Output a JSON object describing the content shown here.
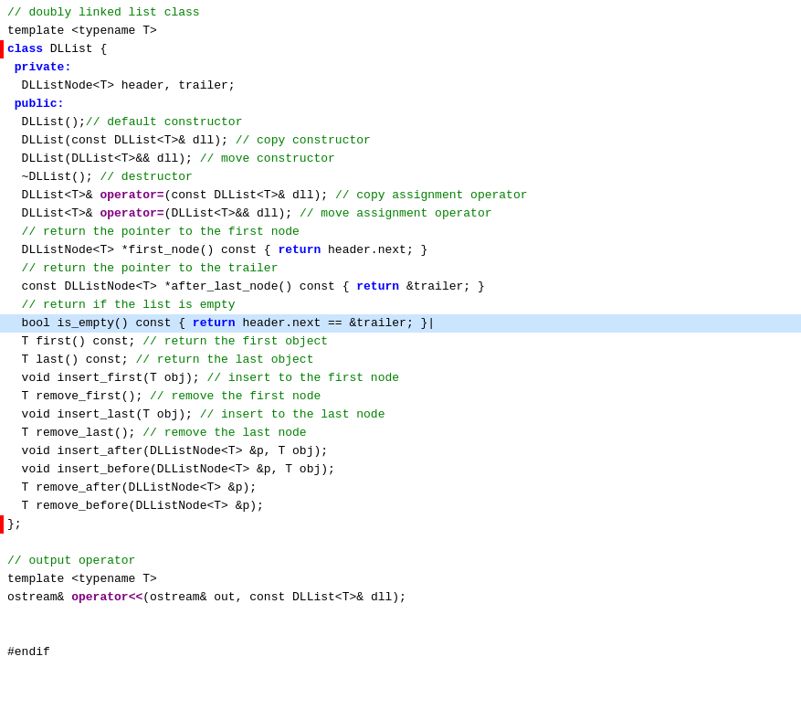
{
  "code": {
    "title": "C++ DLList class code",
    "lines": [
      {
        "id": 1,
        "highlighted": false,
        "red_marker": false,
        "tokens": [
          {
            "cls": "c-comment",
            "text": "// doubly linked list class"
          }
        ]
      },
      {
        "id": 2,
        "highlighted": false,
        "red_marker": false,
        "tokens": [
          {
            "cls": "c-normal",
            "text": "template <typename T>"
          }
        ]
      },
      {
        "id": 3,
        "highlighted": false,
        "red_marker": true,
        "tokens": [
          {
            "cls": "c-keyword",
            "text": "class"
          },
          {
            "cls": "c-normal",
            "text": " DLList {"
          }
        ]
      },
      {
        "id": 4,
        "highlighted": false,
        "red_marker": false,
        "tokens": [
          {
            "cls": "c-keyword",
            "text": " private:"
          }
        ]
      },
      {
        "id": 5,
        "highlighted": false,
        "red_marker": false,
        "tokens": [
          {
            "cls": "c-normal",
            "text": "  DLListNode<T> header, trailer;"
          }
        ]
      },
      {
        "id": 6,
        "highlighted": false,
        "red_marker": false,
        "tokens": [
          {
            "cls": "c-keyword",
            "text": " public:"
          }
        ]
      },
      {
        "id": 7,
        "highlighted": false,
        "red_marker": false,
        "tokens": [
          {
            "cls": "c-normal",
            "text": "  DLList();"
          },
          {
            "cls": "c-comment",
            "text": "// default constructor"
          }
        ]
      },
      {
        "id": 8,
        "highlighted": false,
        "red_marker": false,
        "tokens": [
          {
            "cls": "c-normal",
            "text": "  DLList(const DLList<T>& dll); "
          },
          {
            "cls": "c-comment",
            "text": "// copy constructor"
          }
        ]
      },
      {
        "id": 9,
        "highlighted": false,
        "red_marker": false,
        "tokens": [
          {
            "cls": "c-normal",
            "text": "  DLList(DLList<T>&& dll); "
          },
          {
            "cls": "c-comment",
            "text": "// move constructor"
          }
        ]
      },
      {
        "id": 10,
        "highlighted": false,
        "red_marker": false,
        "tokens": [
          {
            "cls": "c-normal",
            "text": "  ~DLList(); "
          },
          {
            "cls": "c-comment",
            "text": "// destructor"
          }
        ]
      },
      {
        "id": 11,
        "highlighted": false,
        "red_marker": false,
        "tokens": [
          {
            "cls": "c-normal",
            "text": "  DLList<T>& "
          },
          {
            "cls": "c-operator-bold",
            "text": "operator="
          },
          {
            "cls": "c-normal",
            "text": "(const DLList<T>& dll); "
          },
          {
            "cls": "c-comment",
            "text": "// copy assignment operator"
          }
        ]
      },
      {
        "id": 12,
        "highlighted": false,
        "red_marker": false,
        "tokens": [
          {
            "cls": "c-normal",
            "text": "  DLList<T>& "
          },
          {
            "cls": "c-operator-bold",
            "text": "operator="
          },
          {
            "cls": "c-normal",
            "text": "(DLList<T>&& dll); "
          },
          {
            "cls": "c-comment",
            "text": "// move assignment operator"
          }
        ]
      },
      {
        "id": 13,
        "highlighted": false,
        "red_marker": false,
        "tokens": [
          {
            "cls": "c-comment",
            "text": "  // return the pointer to the first node"
          }
        ]
      },
      {
        "id": 14,
        "highlighted": false,
        "red_marker": false,
        "tokens": [
          {
            "cls": "c-normal",
            "text": "  DLListNode<T> *first_node() const { "
          },
          {
            "cls": "c-keyword",
            "text": "return"
          },
          {
            "cls": "c-normal",
            "text": " header.next; }"
          }
        ]
      },
      {
        "id": 15,
        "highlighted": false,
        "red_marker": false,
        "tokens": [
          {
            "cls": "c-comment",
            "text": "  // return the pointer to the trailer"
          }
        ]
      },
      {
        "id": 16,
        "highlighted": false,
        "red_marker": false,
        "tokens": [
          {
            "cls": "c-normal",
            "text": "  const DLListNode<T> *after_last_node() const { "
          },
          {
            "cls": "c-keyword",
            "text": "return"
          },
          {
            "cls": "c-normal",
            "text": " &trailer; }"
          }
        ]
      },
      {
        "id": 17,
        "highlighted": false,
        "red_marker": false,
        "tokens": [
          {
            "cls": "c-comment",
            "text": "  // return if the list is empty"
          }
        ]
      },
      {
        "id": 18,
        "highlighted": true,
        "red_marker": false,
        "tokens": [
          {
            "cls": "c-normal",
            "text": "  bool is_empty() const { "
          },
          {
            "cls": "c-keyword",
            "text": "return"
          },
          {
            "cls": "c-normal",
            "text": " header.next == &trailer; }|"
          }
        ]
      },
      {
        "id": 19,
        "highlighted": false,
        "red_marker": false,
        "tokens": [
          {
            "cls": "c-normal",
            "text": "  T first() const; "
          },
          {
            "cls": "c-comment",
            "text": "// return the first object"
          }
        ]
      },
      {
        "id": 20,
        "highlighted": false,
        "red_marker": false,
        "tokens": [
          {
            "cls": "c-normal",
            "text": "  T last() const; "
          },
          {
            "cls": "c-comment",
            "text": "// return the last object"
          }
        ]
      },
      {
        "id": 21,
        "highlighted": false,
        "red_marker": false,
        "tokens": [
          {
            "cls": "c-normal",
            "text": "  void insert_first(T obj); "
          },
          {
            "cls": "c-comment",
            "text": "// insert to the first node"
          }
        ]
      },
      {
        "id": 22,
        "highlighted": false,
        "red_marker": false,
        "tokens": [
          {
            "cls": "c-normal",
            "text": "  T remove_first(); "
          },
          {
            "cls": "c-comment",
            "text": "// remove the first node"
          }
        ]
      },
      {
        "id": 23,
        "highlighted": false,
        "red_marker": false,
        "tokens": [
          {
            "cls": "c-normal",
            "text": "  void insert_last(T obj); "
          },
          {
            "cls": "c-comment",
            "text": "// insert to the last node"
          }
        ]
      },
      {
        "id": 24,
        "highlighted": false,
        "red_marker": false,
        "tokens": [
          {
            "cls": "c-normal",
            "text": "  T remove_last(); "
          },
          {
            "cls": "c-comment",
            "text": "// remove the last node"
          }
        ]
      },
      {
        "id": 25,
        "highlighted": false,
        "red_marker": false,
        "tokens": [
          {
            "cls": "c-normal",
            "text": "  void insert_after(DLListNode<T> &p, T obj);"
          }
        ]
      },
      {
        "id": 26,
        "highlighted": false,
        "red_marker": false,
        "tokens": [
          {
            "cls": "c-normal",
            "text": "  void insert_before(DLListNode<T> &p, T obj);"
          }
        ]
      },
      {
        "id": 27,
        "highlighted": false,
        "red_marker": false,
        "tokens": [
          {
            "cls": "c-normal",
            "text": "  T remove_after(DLListNode<T> &p);"
          }
        ]
      },
      {
        "id": 28,
        "highlighted": false,
        "red_marker": false,
        "tokens": [
          {
            "cls": "c-normal",
            "text": "  T remove_before(DLListNode<T> &p);"
          }
        ]
      },
      {
        "id": 29,
        "highlighted": false,
        "red_marker": true,
        "tokens": [
          {
            "cls": "c-normal",
            "text": "};"
          }
        ]
      },
      {
        "id": 30,
        "highlighted": false,
        "red_marker": false,
        "tokens": [
          {
            "cls": "c-normal",
            "text": ""
          }
        ]
      },
      {
        "id": 31,
        "highlighted": false,
        "red_marker": false,
        "tokens": [
          {
            "cls": "c-comment",
            "text": "// output operator"
          }
        ]
      },
      {
        "id": 32,
        "highlighted": false,
        "red_marker": false,
        "tokens": [
          {
            "cls": "c-normal",
            "text": "template <typename T>"
          }
        ]
      },
      {
        "id": 33,
        "highlighted": false,
        "red_marker": false,
        "tokens": [
          {
            "cls": "c-normal",
            "text": "ostream& "
          },
          {
            "cls": "c-operator-bold",
            "text": "operator<<"
          },
          {
            "cls": "c-normal",
            "text": "(ostream& out, const DLList<T>& dll);"
          }
        ]
      },
      {
        "id": 34,
        "highlighted": false,
        "red_marker": false,
        "tokens": [
          {
            "cls": "c-normal",
            "text": ""
          }
        ]
      },
      {
        "id": 35,
        "highlighted": false,
        "red_marker": false,
        "tokens": [
          {
            "cls": "c-normal",
            "text": ""
          }
        ]
      },
      {
        "id": 36,
        "highlighted": false,
        "red_marker": false,
        "tokens": [
          {
            "cls": "c-normal",
            "text": "#endif"
          }
        ]
      }
    ]
  }
}
